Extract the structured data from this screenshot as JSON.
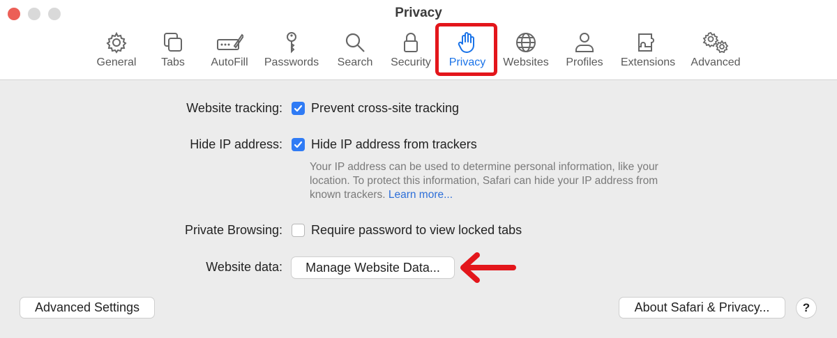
{
  "window": {
    "title": "Privacy"
  },
  "tabs": [
    {
      "label": "General",
      "icon": "gear-icon"
    },
    {
      "label": "Tabs",
      "icon": "tabs-icon"
    },
    {
      "label": "AutoFill",
      "icon": "autofill-icon"
    },
    {
      "label": "Passwords",
      "icon": "key-icon"
    },
    {
      "label": "Search",
      "icon": "search-icon"
    },
    {
      "label": "Security",
      "icon": "lock-icon"
    },
    {
      "label": "Privacy",
      "icon": "hand-icon",
      "active": true
    },
    {
      "label": "Websites",
      "icon": "globe-icon"
    },
    {
      "label": "Profiles",
      "icon": "person-icon"
    },
    {
      "label": "Extensions",
      "icon": "puzzle-icon"
    },
    {
      "label": "Advanced",
      "icon": "gears-icon"
    }
  ],
  "settings": {
    "website_tracking": {
      "label": "Website tracking:",
      "option": "Prevent cross-site tracking",
      "checked": true
    },
    "hide_ip": {
      "label": "Hide IP address:",
      "option": "Hide IP address from trackers",
      "checked": true,
      "description": "Your IP address can be used to determine personal information, like your location. To protect this information, Safari can hide your IP address from known trackers.",
      "learn_more": "Learn more..."
    },
    "private_browsing": {
      "label": "Private Browsing:",
      "option": "Require password to view locked tabs",
      "checked": false
    },
    "website_data": {
      "label": "Website data:",
      "button": "Manage Website Data..."
    }
  },
  "footer": {
    "advanced_settings": "Advanced Settings",
    "about": "About Safari & Privacy...",
    "help": "?"
  },
  "colors": {
    "accent": "#2f7bf5",
    "highlight": "#e3161b",
    "active_tab": "#1a73e8"
  }
}
